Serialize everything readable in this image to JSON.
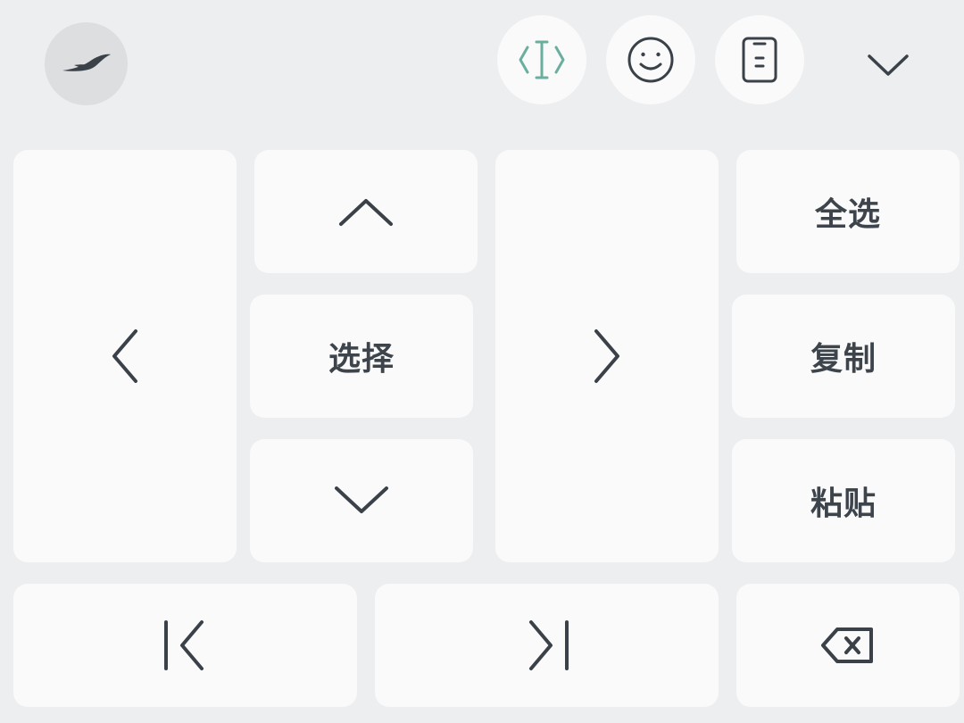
{
  "toolbar": {
    "logo_icon": "swift-bird-logo-icon",
    "cursor_mode_icon": "text-cursor-icon",
    "emoji_icon": "smiley-face-icon",
    "clipboard_icon": "clipboard-icon",
    "collapse_icon": "chevron-down-icon",
    "accent_color": "#6aae9e"
  },
  "keys": {
    "select_all": "全选",
    "select": "选择",
    "copy": "复制",
    "paste": "粘贴",
    "left_icon": "chevron-left-icon",
    "up_icon": "chevron-up-icon",
    "right_icon": "chevron-right-icon",
    "down_icon": "chevron-down-icon",
    "line_start_icon": "line-start-icon",
    "line_end_icon": "line-end-icon",
    "backspace_icon": "backspace-icon"
  },
  "colors": {
    "background": "#eceef0",
    "key": "#fafafa",
    "icon": "#3a4148"
  }
}
